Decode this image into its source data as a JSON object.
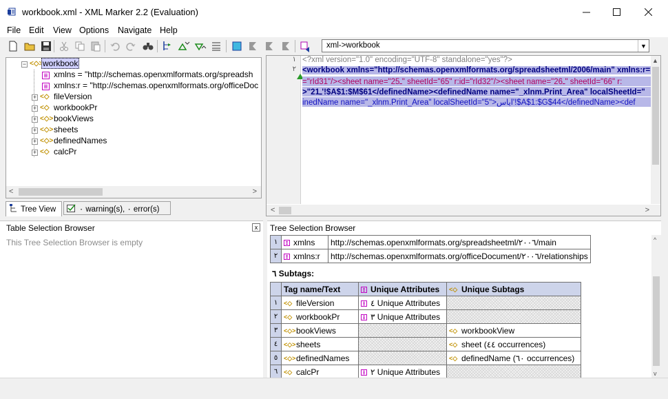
{
  "window": {
    "title": "workbook.xml - XML Marker 2.2 (Evaluation)",
    "minimize": "—",
    "maximize": "☐",
    "close": "✕"
  },
  "menu": [
    "File",
    "Edit",
    "View",
    "Options",
    "Navigate",
    "Help"
  ],
  "toolbar": {
    "path_combo": "xml->workbook"
  },
  "tree": {
    "root": "workbook",
    "items": [
      {
        "type": "attr",
        "text": "xmlns = \"http://schemas.openxmlformats.org/spreadsh"
      },
      {
        "type": "attr",
        "text": "xmlns:r = \"http://schemas.openxmlformats.org/officeDoc"
      },
      {
        "type": "tag",
        "text": "fileVersion"
      },
      {
        "type": "tag",
        "text": "workbookPr"
      },
      {
        "type": "tag",
        "text": "bookViews"
      },
      {
        "type": "tag",
        "text": "sheets"
      },
      {
        "type": "tag",
        "text": "definedNames"
      },
      {
        "type": "tag",
        "text": "calcPr"
      }
    ]
  },
  "tabs": {
    "tree_view": "Tree View",
    "warnings": "۰ warning(s), ۰ error(s)"
  },
  "editor": {
    "line1_num": "١",
    "line2_num": "٢",
    "line1": "<?xml version=\"1.0\" encoding=\"UTF-8\" standalone=\"yes\"?>",
    "line2a": "<workbook xmlns=\"http://schemas.openxmlformats.org/spreadsheetml/2006/main\" xmlns:r=",
    "line2b": "=\"rId31\"/><sheet name=\"2ـ5\" sheetId=\"65\" r:id=\"rId32\"/><sheet name=\"2ـ6\" sheetId=\"66\" r:",
    "line2c": ">\"2ـ1'!$A$1:$M$61</definedName><definedName name=\"_xlnm.Print_Area\" localSheetId=\"",
    "line2d": "inedName name=\"_xlnm.Print_Area\" localSheetId=\"5\">اياس'!$A$1:$G$44</definedName><def"
  },
  "table_browser": {
    "title": "Table Selection Browser",
    "empty": "This Tree Selection Browser is empty",
    "close": "x"
  },
  "tree_browser": {
    "title": "Tree Selection Browser",
    "attributes": [
      {
        "n": "١",
        "name": "xmlns",
        "value": "http://schemas.openxmlformats.org/spreadsheetml/٢٠٠٦/main"
      },
      {
        "n": "٢",
        "name": "xmlns:r",
        "value": "http://schemas.openxmlformats.org/officeDocument/٢٠٠٦/relationships"
      }
    ],
    "subtags_label": "٦ Subtags:",
    "headers": [
      "Tag name/Text",
      "Unique Attributes",
      "Unique Subtags"
    ],
    "rows": [
      {
        "n": "١",
        "tag": "fileVersion",
        "attrs": "٤ Unique Attributes",
        "subtags": ""
      },
      {
        "n": "٢",
        "tag": "workbookPr",
        "attrs": "٣ Unique Attributes",
        "subtags": ""
      },
      {
        "n": "٣",
        "tag": "bookViews",
        "attrs": "",
        "subtags": "workbookView"
      },
      {
        "n": "٤",
        "tag": "sheets",
        "attrs": "",
        "subtags": "sheet (٤٤ occurrences)"
      },
      {
        "n": "٥",
        "tag": "definedNames",
        "attrs": "",
        "subtags": "definedName (٦٠ occurrences)"
      },
      {
        "n": "٦",
        "tag": "calcPr",
        "attrs": "٢ Unique Attributes",
        "subtags": ""
      }
    ]
  }
}
